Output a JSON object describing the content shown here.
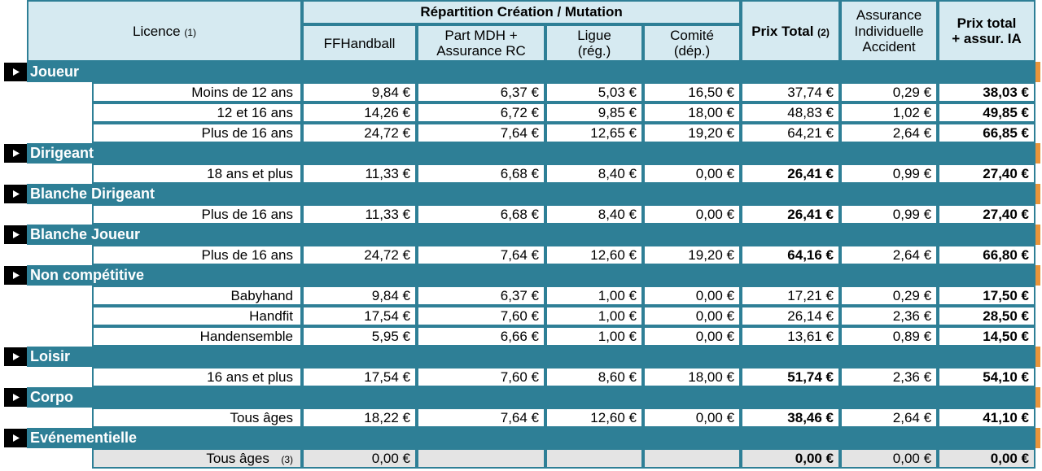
{
  "table": {
    "header": {
      "licence_label": "Licence",
      "licence_note": "(1)",
      "group_label": "Répartition Création / Mutation",
      "col_ffhandball": "FFHandball",
      "col_mdh_line1": "Part MDH +",
      "col_mdh_line2": "Assurance RC",
      "col_ligue_line1": "Ligue",
      "col_ligue_line2": "(rég.)",
      "col_comite_line1": "Comité",
      "col_comite_line2": "(dép.)",
      "col_prix_total": "Prix Total",
      "col_prix_total_note": "(2)",
      "col_assurance_line1": "Assurance",
      "col_assurance_line2": "Individuelle",
      "col_assurance_line3": "Accident",
      "col_prix_total_ia_line1": "Prix total",
      "col_prix_total_ia_line2": "+ assur. IA"
    },
    "colors": {
      "teal": "#2E7F96",
      "header_fill": "#D6EAF1",
      "grey_row": "#E4E4E4",
      "orange_edge": "#E8943A",
      "arrow_box": "#000000"
    },
    "categories": [
      {
        "name": "Joueur",
        "rows": [
          {
            "label": "Moins de 12 ans",
            "ffhandball": "9,84 €",
            "mdh": "6,37 €",
            "ligue": "5,03 €",
            "comite": "16,50 €",
            "prix_total": "37,74 €",
            "assurance": "0,29 €",
            "prix_total_ia": "38,03 €",
            "total_bold": false
          },
          {
            "label": "12 et 16 ans",
            "ffhandball": "14,26 €",
            "mdh": "6,72 €",
            "ligue": "9,85 €",
            "comite": "18,00 €",
            "prix_total": "48,83 €",
            "assurance": "1,02 €",
            "prix_total_ia": "49,85 €",
            "total_bold": false
          },
          {
            "label": "Plus de 16 ans",
            "ffhandball": "24,72 €",
            "mdh": "7,64 €",
            "ligue": "12,65 €",
            "comite": "19,20 €",
            "prix_total": "64,21 €",
            "assurance": "2,64 €",
            "prix_total_ia": "66,85 €",
            "total_bold": false
          }
        ]
      },
      {
        "name": "Dirigeant",
        "rows": [
          {
            "label": "18 ans et plus",
            "ffhandball": "11,33 €",
            "mdh": "6,68 €",
            "ligue": "8,40 €",
            "comite": "0,00 €",
            "prix_total": "26,41 €",
            "assurance": "0,99 €",
            "prix_total_ia": "27,40 €",
            "total_bold": true
          }
        ]
      },
      {
        "name": "Blanche Dirigeant",
        "rows": [
          {
            "label": "Plus de 16 ans",
            "ffhandball": "11,33 €",
            "mdh": "6,68 €",
            "ligue": "8,40 €",
            "comite": "0,00 €",
            "prix_total": "26,41 €",
            "assurance": "0,99 €",
            "prix_total_ia": "27,40 €",
            "total_bold": true
          }
        ]
      },
      {
        "name": "Blanche Joueur",
        "rows": [
          {
            "label": "Plus de 16 ans",
            "ffhandball": "24,72 €",
            "mdh": "7,64 €",
            "ligue": "12,60 €",
            "comite": "19,20 €",
            "prix_total": "64,16 €",
            "assurance": "2,64 €",
            "prix_total_ia": "66,80 €",
            "total_bold": true
          }
        ]
      },
      {
        "name": "Non compétitive",
        "rows": [
          {
            "label": "Babyhand",
            "ffhandball": "9,84 €",
            "mdh": "6,37 €",
            "ligue": "1,00 €",
            "comite": "0,00 €",
            "prix_total": "17,21 €",
            "assurance": "0,29 €",
            "prix_total_ia": "17,50 €",
            "total_bold": false
          },
          {
            "label": "Handfit",
            "ffhandball": "17,54 €",
            "mdh": "7,60 €",
            "ligue": "1,00 €",
            "comite": "0,00 €",
            "prix_total": "26,14 €",
            "assurance": "2,36 €",
            "prix_total_ia": "28,50 €",
            "total_bold": false
          },
          {
            "label": "Handensemble",
            "ffhandball": "5,95 €",
            "mdh": "6,66 €",
            "ligue": "1,00 €",
            "comite": "0,00 €",
            "prix_total": "13,61 €",
            "assurance": "0,89 €",
            "prix_total_ia": "14,50 €",
            "total_bold": false
          }
        ]
      },
      {
        "name": "Loisir",
        "rows": [
          {
            "label": "16 ans et plus",
            "ffhandball": "17,54 €",
            "mdh": "7,60 €",
            "ligue": "8,60 €",
            "comite": "18,00 €",
            "prix_total": "51,74 €",
            "assurance": "2,36 €",
            "prix_total_ia": "54,10 €",
            "total_bold": true
          }
        ]
      },
      {
        "name": "Corpo",
        "rows": [
          {
            "label": "Tous âges",
            "ffhandball": "18,22 €",
            "mdh": "7,64 €",
            "ligue": "12,60 €",
            "comite": "0,00 €",
            "prix_total": "38,46 €",
            "assurance": "2,64 €",
            "prix_total_ia": "41,10 €",
            "total_bold": true
          }
        ]
      },
      {
        "name": "Evénementielle",
        "rows": [
          {
            "label": "Tous âges",
            "label_note": "(3)",
            "ffhandball": "0,00 €",
            "mdh": "",
            "ligue": "",
            "comite": "",
            "prix_total": "0,00 €",
            "assurance": "0,00 €",
            "prix_total_ia": "0,00 €",
            "total_bold": true,
            "grey": true
          }
        ]
      }
    ]
  }
}
